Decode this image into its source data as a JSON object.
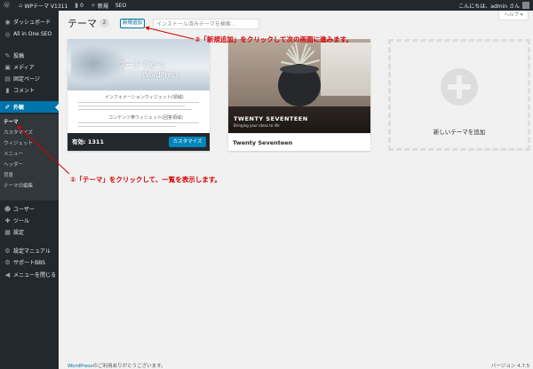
{
  "admin_bar": {
    "wp_logo_icon": "wordpress-logo-icon",
    "site_name": "WPテーマ V1311",
    "comments_count": "0",
    "new_label": "新規",
    "seo_label": "SEO",
    "greeting": "こんにちは、admin さん"
  },
  "sidebar": {
    "items": [
      {
        "label": "ダッシュボード",
        "icon": "dashboard-icon",
        "glyph": "◉"
      },
      {
        "label": "All in One SEO",
        "icon": "seo-icon",
        "glyph": "◎"
      },
      {
        "label": "投稿",
        "icon": "pin-icon",
        "glyph": "✎"
      },
      {
        "label": "メディア",
        "icon": "media-icon",
        "glyph": "▣"
      },
      {
        "label": "固定ページ",
        "icon": "page-icon",
        "glyph": "▤"
      },
      {
        "label": "コメント",
        "icon": "comment-icon",
        "glyph": "▮"
      },
      {
        "label": "外観",
        "icon": "appearance-icon",
        "glyph": "✐"
      },
      {
        "label": "プラグイン",
        "icon": "plugin-icon",
        "glyph": "⚙"
      },
      {
        "label": "ユーザー",
        "icon": "users-icon",
        "glyph": "☻"
      },
      {
        "label": "ツール",
        "icon": "tools-icon",
        "glyph": "✚"
      },
      {
        "label": "設定",
        "icon": "settings-icon",
        "glyph": "▦"
      },
      {
        "label": "設定マニュアル",
        "icon": "manual-icon",
        "glyph": "⚙"
      },
      {
        "label": "サポートBBS",
        "icon": "support-icon",
        "glyph": "⚙"
      },
      {
        "label": "メニューを閉じる",
        "icon": "collapse-icon",
        "glyph": "◀"
      }
    ],
    "submenu": [
      "テーマ",
      "カスタマイズ",
      "ウィジェット",
      "メニュー",
      "ヘッダー",
      "背景",
      "テーマの編集"
    ]
  },
  "header": {
    "title": "テーマ",
    "count": "2",
    "add_new": "新規追加",
    "search_placeholder": "インストール済みテーマを検索...",
    "help": "ヘルプ ▾"
  },
  "themes": [
    {
      "name": "1311",
      "active_label": "有効:",
      "customize_label": "カスタマイズ",
      "hero_line1": "ワードでかっ",
      "hero_line2": "WordPress",
      "shot_heading1": "インフォメーションウィジェット(領域)",
      "shot_heading2": "コンテンツ帯ウィジェット(回答領域)"
    },
    {
      "name": "Twenty Seventeen",
      "shot_title": "TWENTY SEVENTEEN",
      "shot_sub": "Bringing your ideas to life"
    }
  ],
  "add_new_card_label": "新しいテーマを追加",
  "annotations": {
    "note1": "①「テーマ」をクリックして、一覧を表示します。",
    "note2": "②「新規追加」をクリックして次の画面に進みます。"
  },
  "footer": {
    "wp_link": "WordPress",
    "thanks": "のご利用ありがとうございます。",
    "version": "バージョン 4.7.5"
  },
  "colors": {
    "admin_bg": "#23282d",
    "active_blue": "#0073aa",
    "annotation_red": "#d40000"
  }
}
